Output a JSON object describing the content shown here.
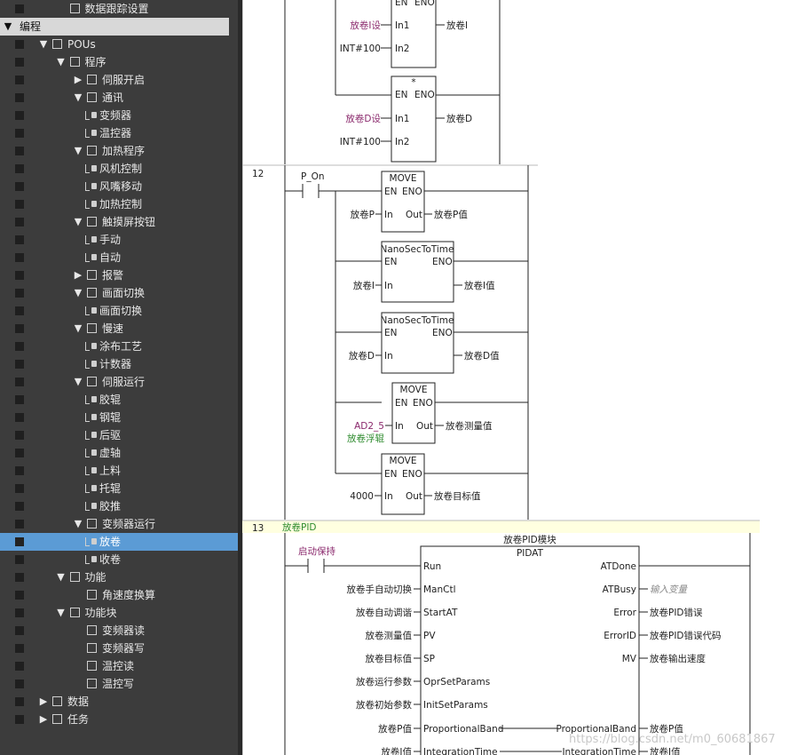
{
  "tree": {
    "items": [
      {
        "label": "数据跟踪设置",
        "depth": 3,
        "arrow": "",
        "icon": "trace-icon"
      },
      {
        "label": "编程",
        "depth": 0,
        "arrow": "▼",
        "icon": "",
        "header": true
      },
      {
        "label": "POUs",
        "depth": 2,
        "arrow": "▼",
        "icon": "pou-icon"
      },
      {
        "label": "程序",
        "depth": 3,
        "arrow": "▼",
        "icon": "program-folder-icon"
      },
      {
        "label": "伺服开启",
        "depth": 4,
        "arrow": "▶",
        "icon": "section-icon"
      },
      {
        "label": "通讯",
        "depth": 4,
        "arrow": "▼",
        "icon": "section-icon"
      },
      {
        "label": "变频器",
        "depth": 5,
        "arrow": "",
        "icon": "leaf"
      },
      {
        "label": "温控器",
        "depth": 5,
        "arrow": "",
        "icon": "leaf"
      },
      {
        "label": "加热程序",
        "depth": 4,
        "arrow": "▼",
        "icon": "section-icon"
      },
      {
        "label": "风机控制",
        "depth": 5,
        "arrow": "",
        "icon": "leaf"
      },
      {
        "label": "风嘴移动",
        "depth": 5,
        "arrow": "",
        "icon": "leaf"
      },
      {
        "label": "加热控制",
        "depth": 5,
        "arrow": "",
        "icon": "leaf"
      },
      {
        "label": "触摸屏按钮",
        "depth": 4,
        "arrow": "▼",
        "icon": "section-icon"
      },
      {
        "label": "手动",
        "depth": 5,
        "arrow": "",
        "icon": "leaf"
      },
      {
        "label": "自动",
        "depth": 5,
        "arrow": "",
        "icon": "leaf"
      },
      {
        "label": "报警",
        "depth": 4,
        "arrow": "▶",
        "icon": "section-icon"
      },
      {
        "label": "画面切换",
        "depth": 4,
        "arrow": "▼",
        "icon": "section-icon"
      },
      {
        "label": "画面切换",
        "depth": 5,
        "arrow": "",
        "icon": "leaf"
      },
      {
        "label": "慢速",
        "depth": 4,
        "arrow": "▼",
        "icon": "section-icon"
      },
      {
        "label": "涂布工艺",
        "depth": 5,
        "arrow": "",
        "icon": "leaf"
      },
      {
        "label": "计数器",
        "depth": 5,
        "arrow": "",
        "icon": "leaf"
      },
      {
        "label": "伺服运行",
        "depth": 4,
        "arrow": "▼",
        "icon": "section-icon"
      },
      {
        "label": "胶辊",
        "depth": 5,
        "arrow": "",
        "icon": "leaf"
      },
      {
        "label": "钢辊",
        "depth": 5,
        "arrow": "",
        "icon": "leaf"
      },
      {
        "label": "后驱",
        "depth": 5,
        "arrow": "",
        "icon": "leaf"
      },
      {
        "label": "虚轴",
        "depth": 5,
        "arrow": "",
        "icon": "leaf"
      },
      {
        "label": "上料",
        "depth": 5,
        "arrow": "",
        "icon": "leaf"
      },
      {
        "label": "托辊",
        "depth": 5,
        "arrow": "",
        "icon": "leaf"
      },
      {
        "label": "胶推",
        "depth": 5,
        "arrow": "",
        "icon": "leaf"
      },
      {
        "label": "变频器运行",
        "depth": 4,
        "arrow": "▼",
        "icon": "section-icon"
      },
      {
        "label": "放卷",
        "depth": 5,
        "arrow": "",
        "icon": "leaf",
        "selected": true
      },
      {
        "label": "收卷",
        "depth": 5,
        "arrow": "",
        "icon": "leaf"
      },
      {
        "label": "功能",
        "depth": 3,
        "arrow": "▼",
        "icon": "function-folder-icon"
      },
      {
        "label": "角速度换算",
        "depth": 4,
        "arrow": "",
        "icon": "function-icon"
      },
      {
        "label": "功能块",
        "depth": 3,
        "arrow": "▼",
        "icon": "fb-folder-icon"
      },
      {
        "label": "变频器读",
        "depth": 4,
        "arrow": "",
        "icon": "fb-leaf"
      },
      {
        "label": "变频器写",
        "depth": 4,
        "arrow": "",
        "icon": "fb-leaf"
      },
      {
        "label": "温控读",
        "depth": 4,
        "arrow": "",
        "icon": "fb-leaf"
      },
      {
        "label": "温控写",
        "depth": 4,
        "arrow": "",
        "icon": "fb-leaf"
      },
      {
        "label": "数据",
        "depth": 2,
        "arrow": "▶",
        "icon": "data-icon"
      },
      {
        "label": "任务",
        "depth": 2,
        "arrow": "▶",
        "icon": "task-icon"
      }
    ]
  },
  "ladder": {
    "rung11": {
      "mul1": {
        "en": "EN",
        "eno": "ENO",
        "in1": "In1",
        "in2": "In2",
        "in1_var": "放卷I设",
        "in2_var": "INT#100",
        "out_var": "放卷I"
      },
      "mul2": {
        "title": "*",
        "en": "EN",
        "eno": "ENO",
        "in1": "In1",
        "in2": "In2",
        "in1_var": "放卷D设",
        "in2_var": "INT#100",
        "out_var": "放卷D"
      }
    },
    "rung12": {
      "number": "12",
      "contact": "P_On",
      "move1": {
        "title": "MOVE",
        "en": "EN",
        "eno": "ENO",
        "in": "In",
        "out": "Out",
        "in_var": "放卷P",
        "out_var": "放卷P值"
      },
      "ns1": {
        "title": "NanoSecToTime",
        "en": "EN",
        "eno": "ENO",
        "in": "In",
        "in_var": "放卷I",
        "out_var": "放卷I值"
      },
      "ns2": {
        "title": "NanoSecToTime",
        "en": "EN",
        "eno": "ENO",
        "in": "In",
        "in_var": "放卷D",
        "out_var": "放卷D值"
      },
      "move2": {
        "title": "MOVE",
        "en": "EN",
        "eno": "ENO",
        "in": "In",
        "out": "Out",
        "in_var": "AD2_5",
        "in_comment": "放卷浮辊",
        "out_var": "放卷测量值"
      },
      "move3": {
        "title": "MOVE",
        "en": "EN",
        "eno": "ENO",
        "in": "In",
        "out": "Out",
        "in_var": "4000",
        "out_var": "放卷目标值"
      }
    },
    "rung13": {
      "number": "13",
      "comment": "放卷PID",
      "contact": "启动保持",
      "block_name": "放卷PID模块",
      "block_type": "PIDAT",
      "inputs": [
        {
          "var": "",
          "pin": "Run"
        },
        {
          "var": "放卷手自动切换",
          "pin": "ManCtl"
        },
        {
          "var": "放卷自动调谐",
          "pin": "StartAT"
        },
        {
          "var": "放卷测量值",
          "pin": "PV"
        },
        {
          "var": "放卷目标值",
          "pin": "SP"
        },
        {
          "var": "放卷运行参数",
          "pin": "OprSetParams"
        },
        {
          "var": "放卷初始参数",
          "pin": "InitSetParams"
        },
        {
          "var": "放卷P值",
          "pin": "ProportionalBand"
        },
        {
          "var": "放卷I值",
          "pin": "IntegrationTime"
        }
      ],
      "outputs": [
        {
          "pin": "ATDone",
          "var": "",
          "style": "normal"
        },
        {
          "pin": "ATBusy",
          "var": "输入变量",
          "style": "placeholder"
        },
        {
          "pin": "Error",
          "var": "放卷PID错误",
          "style": "normal"
        },
        {
          "pin": "ErrorID",
          "var": "放卷PID错误代码",
          "style": "normal"
        },
        {
          "pin": "MV",
          "var": "放卷输出速度",
          "style": "normal"
        },
        {
          "pin": "",
          "var": "",
          "style": "normal"
        },
        {
          "pin": "",
          "var": "",
          "style": "normal"
        },
        {
          "pin": "ProportionalBand",
          "var": "放卷P值",
          "style": "normal"
        },
        {
          "pin": "IntegrationTime",
          "var": "放卷I值",
          "style": "normal"
        }
      ]
    },
    "watermark": "https://blog.csdn.net/m0_60681867"
  },
  "colors": {
    "tree_bg": "#3c3c3c",
    "selected": "#5b9bd5",
    "variable": "#8b2a6d",
    "comment": "#2e8b2e",
    "rung_comment_bg": "#ffffe0"
  }
}
